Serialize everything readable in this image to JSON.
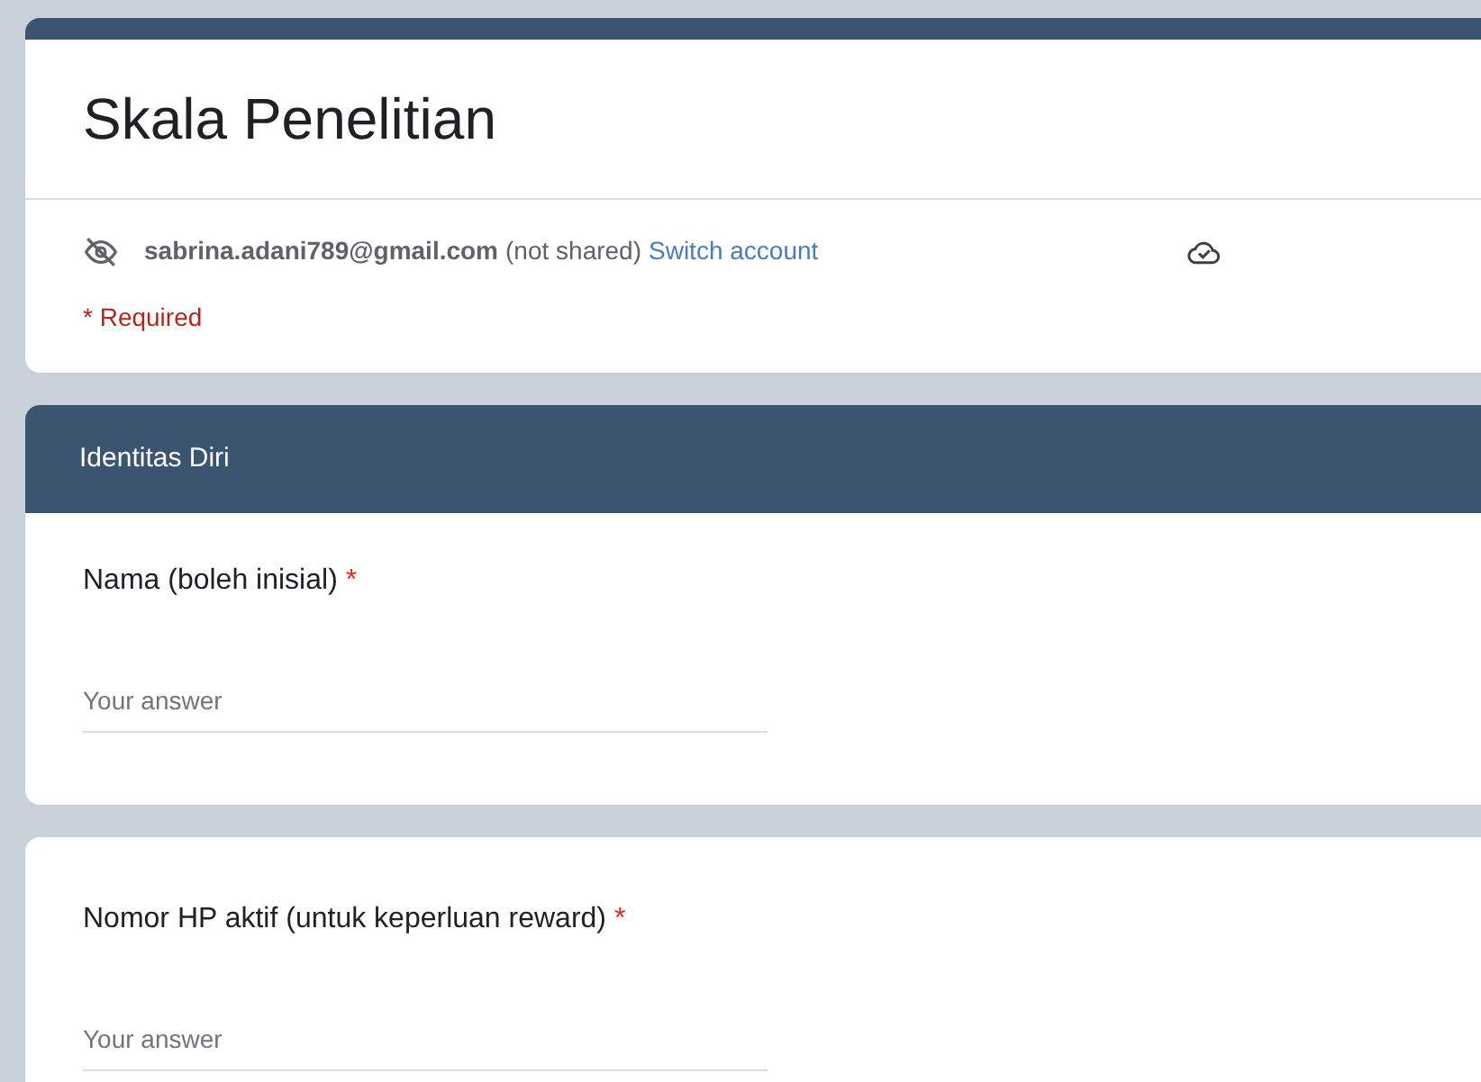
{
  "form": {
    "title": "Skala Penelitian",
    "account": {
      "email": "sabrina.adani789@gmail.com",
      "sharing": "(not shared)",
      "switch_link": "Switch account"
    },
    "required_note": "* Required"
  },
  "sections": [
    {
      "header": "Identitas Diri",
      "questions": [
        {
          "label": "Nama (boleh inisial)",
          "required_mark": "*",
          "placeholder": "Your answer"
        }
      ]
    },
    {
      "questions": [
        {
          "label": "Nomor HP aktif (untuk keperluan reward)",
          "required_mark": "*",
          "placeholder": "Your answer"
        }
      ]
    }
  ]
}
